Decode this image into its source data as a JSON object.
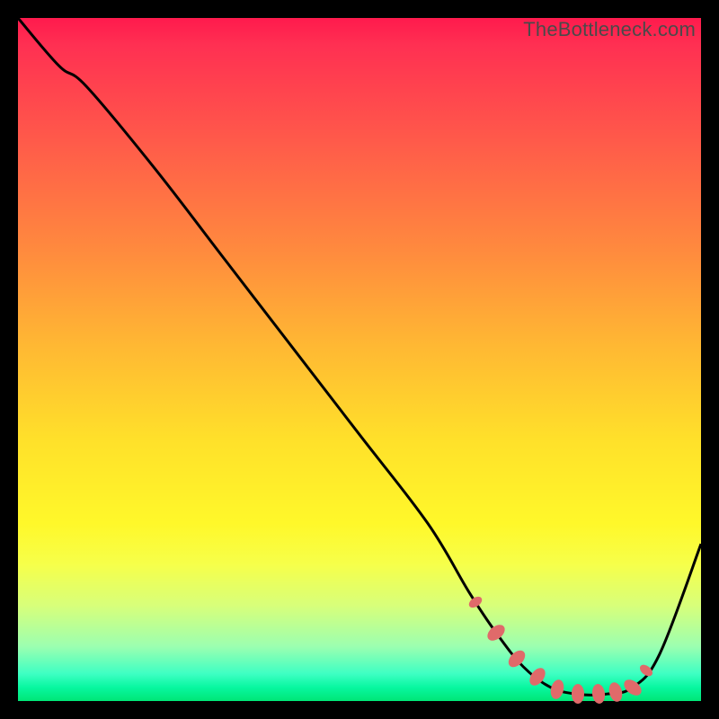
{
  "watermark": "TheBottleneck.com",
  "chart_data": {
    "type": "line",
    "title": "",
    "xlabel": "",
    "ylabel": "",
    "xlim": [
      0,
      100
    ],
    "ylim": [
      0,
      100
    ],
    "series": [
      {
        "name": "bottleneck-curve",
        "x": [
          0,
          6,
          10,
          20,
          30,
          40,
          50,
          60,
          66,
          70,
          74,
          78,
          82,
          86,
          90,
          94,
          100
        ],
        "values": [
          100,
          93,
          90,
          78,
          65,
          52,
          39,
          26,
          16,
          10,
          5,
          2,
          1,
          1,
          2,
          7,
          23
        ]
      }
    ],
    "optimal_zone_x": [
      67,
      92
    ],
    "bead_positions_x": [
      67,
      70,
      73,
      76,
      79,
      82,
      85,
      87.5,
      90,
      92
    ],
    "background_gradient": {
      "top": "#ff1a4d",
      "mid": "#ffe12a",
      "bottom": "#00e676"
    },
    "bead_color": "#e06a6a",
    "curve_color": "#000000"
  }
}
